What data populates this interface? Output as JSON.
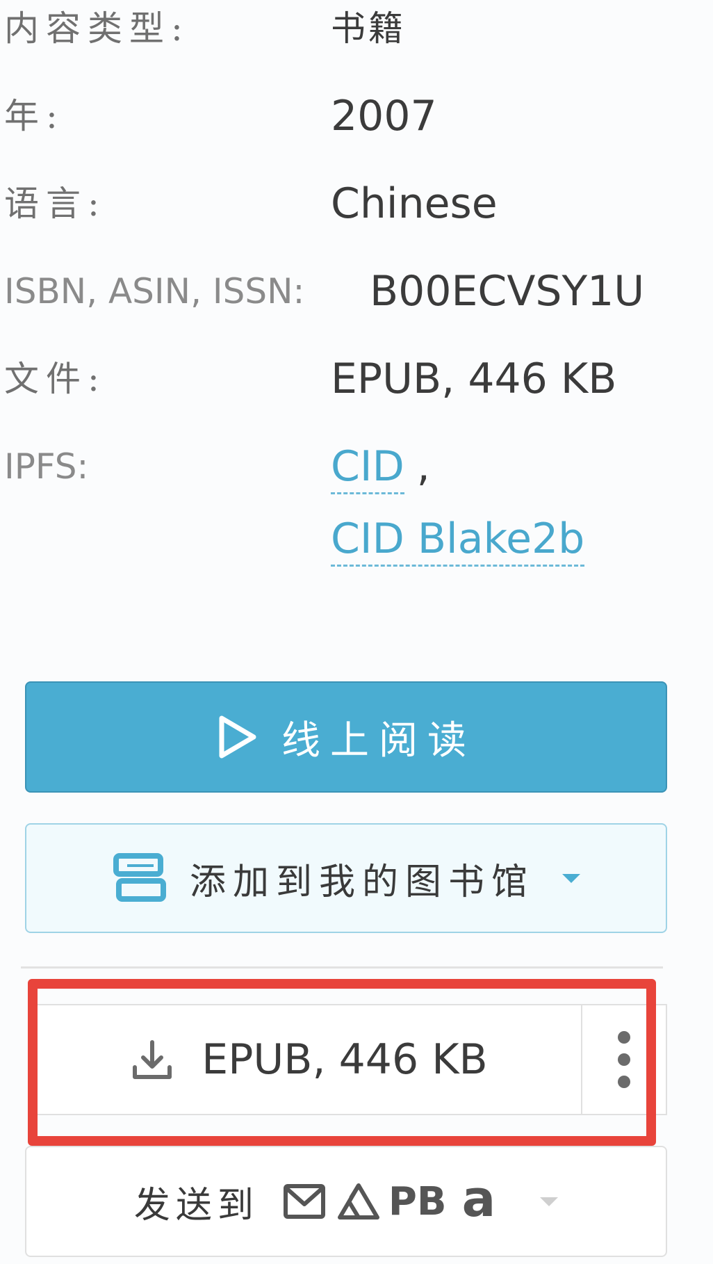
{
  "details": [
    {
      "label": "内容类型:",
      "value": "书籍"
    },
    {
      "label": "年:",
      "value": "2007"
    },
    {
      "label": "语言:",
      "value": "Chinese"
    },
    {
      "label": "ISBN, ASIN, ISSN:",
      "value": "B00ECVSY1U"
    },
    {
      "label": "文件:",
      "value": "EPUB, 446 KB"
    }
  ],
  "ipfs": {
    "label": "IPFS:",
    "link1": "CID",
    "comma": ",",
    "link2": "CID Blake2b"
  },
  "actions": {
    "read_online": "线上阅读",
    "add_to_library": "添加到我的图书馆",
    "download": "EPUB, 446 KB",
    "send_to": "发送到",
    "send_pb": "PB",
    "send_amazon": "a"
  },
  "colors": {
    "accent": "#4aadd2",
    "highlight": "#e8443b"
  },
  "icons": {
    "read": "play-icon",
    "library": "library-icon",
    "download": "download-icon",
    "more": "more-vertical-icon",
    "email": "mail-icon",
    "drive": "google-drive-icon",
    "amazon": "amazon-icon"
  }
}
